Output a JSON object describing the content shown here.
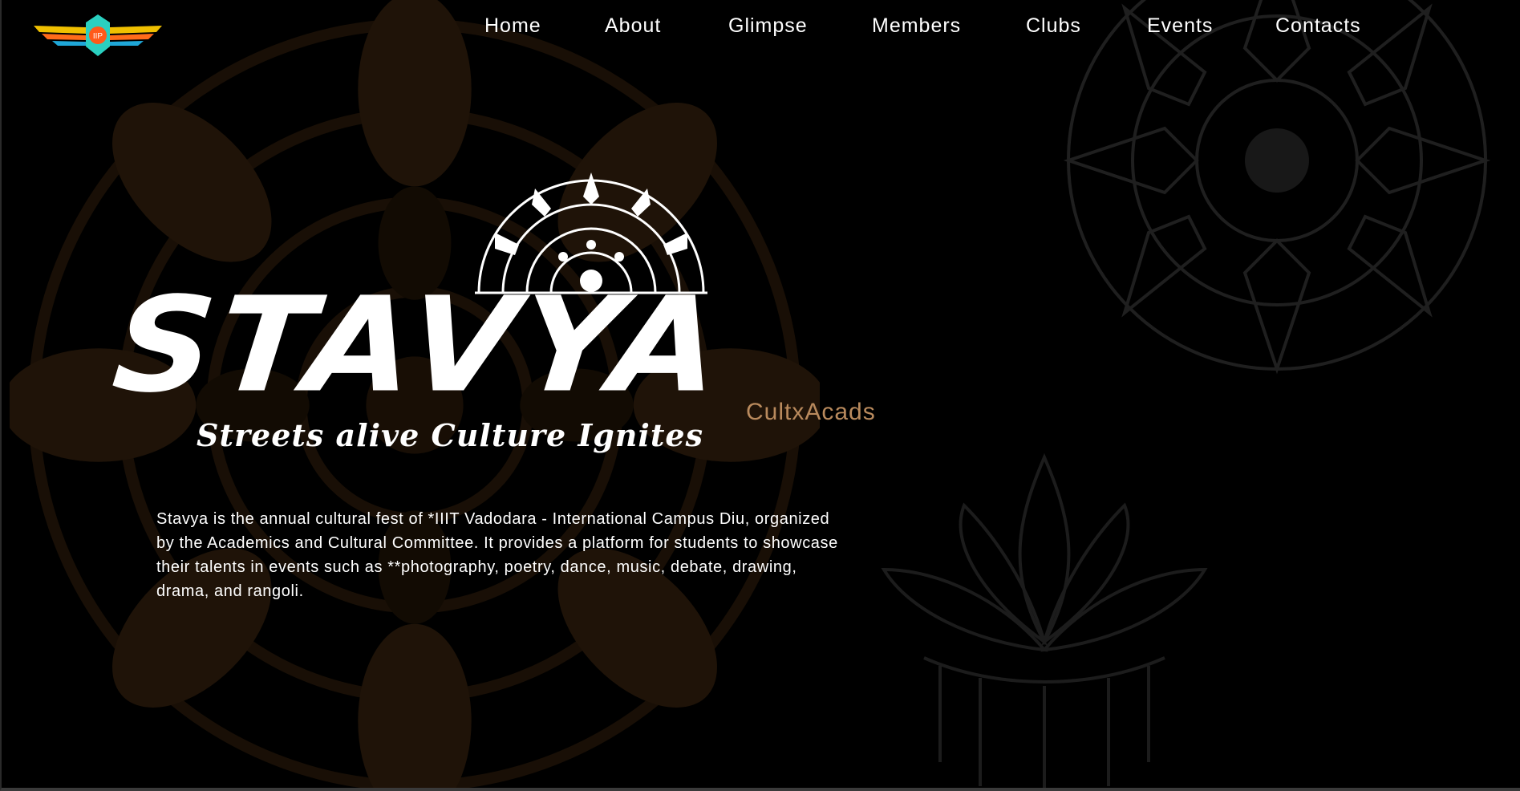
{
  "header": {
    "logo_icon": "iiit-winged-logo",
    "nav": [
      {
        "label": "Home"
      },
      {
        "label": "About"
      },
      {
        "label": "Glimpse"
      },
      {
        "label": "Members"
      },
      {
        "label": "Clubs"
      },
      {
        "label": "Events"
      },
      {
        "label": "Contacts"
      }
    ]
  },
  "hero": {
    "title": "STAVYA",
    "sub_brand": "CultxAcads",
    "motto": "Streets alive Culture Ignites",
    "description": "Stavya is the annual cultural fest of *IIIT Vadodara - International Campus Diu, organized by the Academics and Cultural Committee. It provides a platform for students to showcase their talents in events such as **photography, poetry, dance, music, debate, drawing, drama, and rangoli.",
    "ornament_icon": "mandala-half-icon"
  },
  "theme": {
    "background": "#000000",
    "accent": "#b98a5d",
    "mandala_brown": "#3a2510",
    "mandala_gray": "#2a2a2a"
  }
}
